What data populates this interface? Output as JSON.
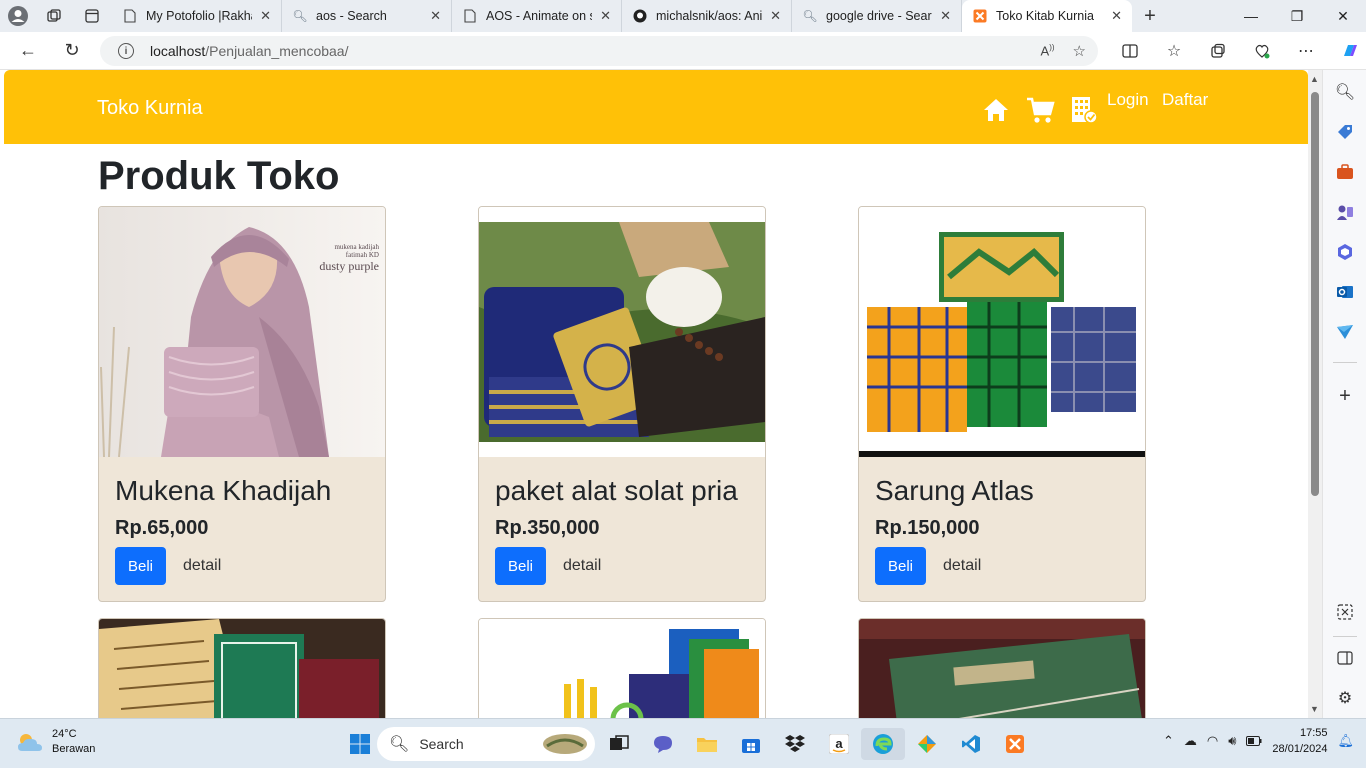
{
  "browser": {
    "tabs": [
      {
        "title": "My Potofolio |Rakha",
        "icon": "page-icon",
        "active": false
      },
      {
        "title": "aos - Search",
        "icon": "search-icon",
        "active": false
      },
      {
        "title": "AOS - Animate on s",
        "icon": "page-icon",
        "active": false
      },
      {
        "title": "michalsnik/aos: Ani",
        "icon": "github-icon",
        "active": false
      },
      {
        "title": "google drive - Searc",
        "icon": "search-icon",
        "active": false
      },
      {
        "title": "Toko Kitab Kurnia",
        "icon": "xampp-icon",
        "active": true
      }
    ],
    "url_host": "localhost",
    "url_path": "/Penjualan_mencobaa/"
  },
  "site": {
    "brand": "Toko Kurnia",
    "nav": {
      "login": "Login",
      "register": "Daftar"
    },
    "nav_icons": [
      "home-icon",
      "cart-icon",
      "store-icon"
    ],
    "page_title": "Produk Toko",
    "colors": {
      "navbar": "#ffc107",
      "card_bg": "#efe6d8",
      "buy_button": "#0d6efd"
    },
    "products": [
      {
        "name": "Mukena Khadijah",
        "price": "Rp.65,000",
        "buy": "Beli",
        "detail": "detail",
        "image": "mukena-photo",
        "image_text": [
          "mukena kadijah",
          "fatimah KD",
          "dusty purple"
        ]
      },
      {
        "name": "paket alat solat pria",
        "price": "Rp.350,000",
        "buy": "Beli",
        "detail": "detail",
        "image": "prayer-set-photo"
      },
      {
        "name": "Sarung Atlas",
        "price": "Rp.150,000",
        "buy": "Beli",
        "detail": "detail",
        "image": "sarong-photo"
      }
    ]
  },
  "taskbar": {
    "weather_temp": "24°C",
    "weather_desc": "Berawan",
    "search_placeholder": "Search",
    "time": "17:55",
    "date": "28/01/2024"
  }
}
